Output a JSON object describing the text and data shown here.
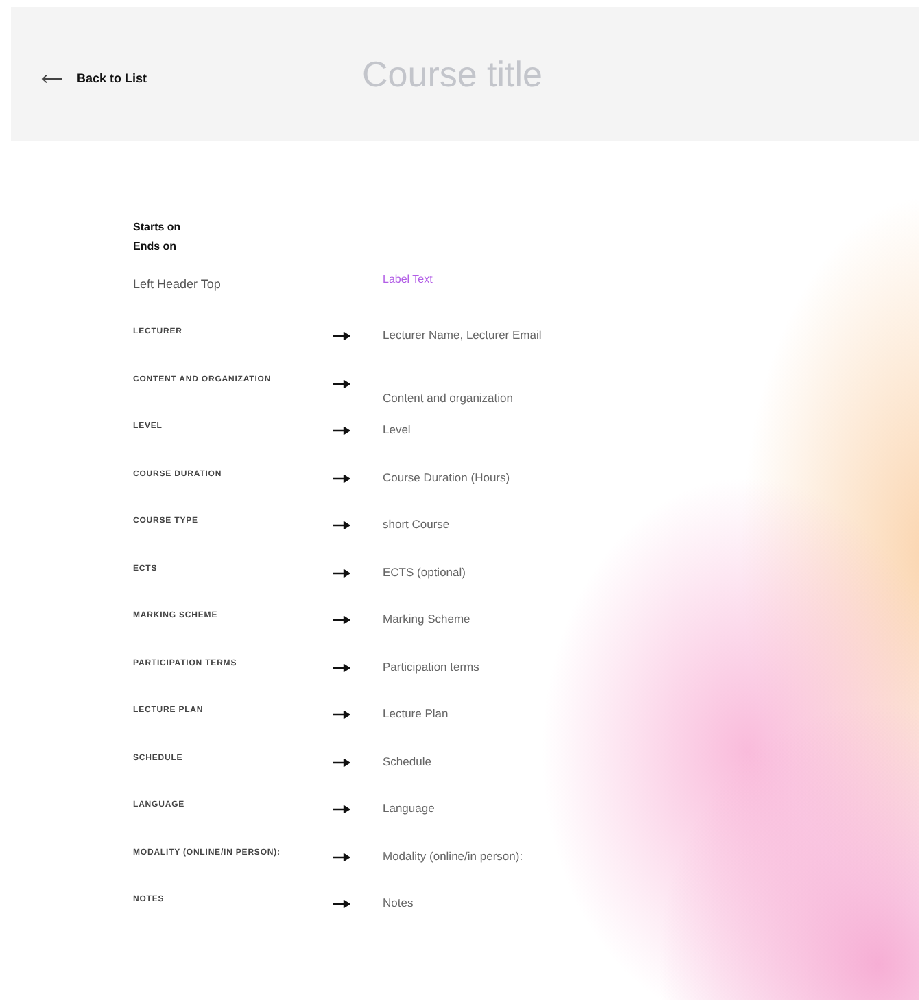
{
  "header": {
    "back_link": "Back to List",
    "title": "Course title"
  },
  "dates": [
    "Starts on",
    "Ends on"
  ],
  "top_row": {
    "left": "Left Header Top",
    "right": "Label Text"
  },
  "fields": [
    {
      "label": "LECTURER",
      "value": "Lecturer Name, Lecturer Email"
    },
    {
      "label": "CONTENT AND ORGANIZATION",
      "value": "Content and organization"
    },
    {
      "label": "LEVEL",
      "value": "Level"
    },
    {
      "label": "COURSE DURATION",
      "value": "Course Duration (Hours)"
    },
    {
      "label": "COURSE TYPE",
      "value": "short Course"
    },
    {
      "label": "ECTS",
      "value": "ECTS (optional)"
    },
    {
      "label": "MARKING SCHEME",
      "value": "Marking Scheme"
    },
    {
      "label": "PARTICIPATION TERMS",
      "value": "Participation terms"
    },
    {
      "label": "LECTURE PLAN",
      "value": "Lecture Plan"
    },
    {
      "label": "SCHEDULE",
      "value": "Schedule"
    },
    {
      "label": "LANGUAGE",
      "value": "Language"
    },
    {
      "label": "MODALITY (ONLINE/IN PERSON):",
      "value": "Modality (online/in person):"
    },
    {
      "label": "NOTES",
      "value": "Notes"
    }
  ]
}
